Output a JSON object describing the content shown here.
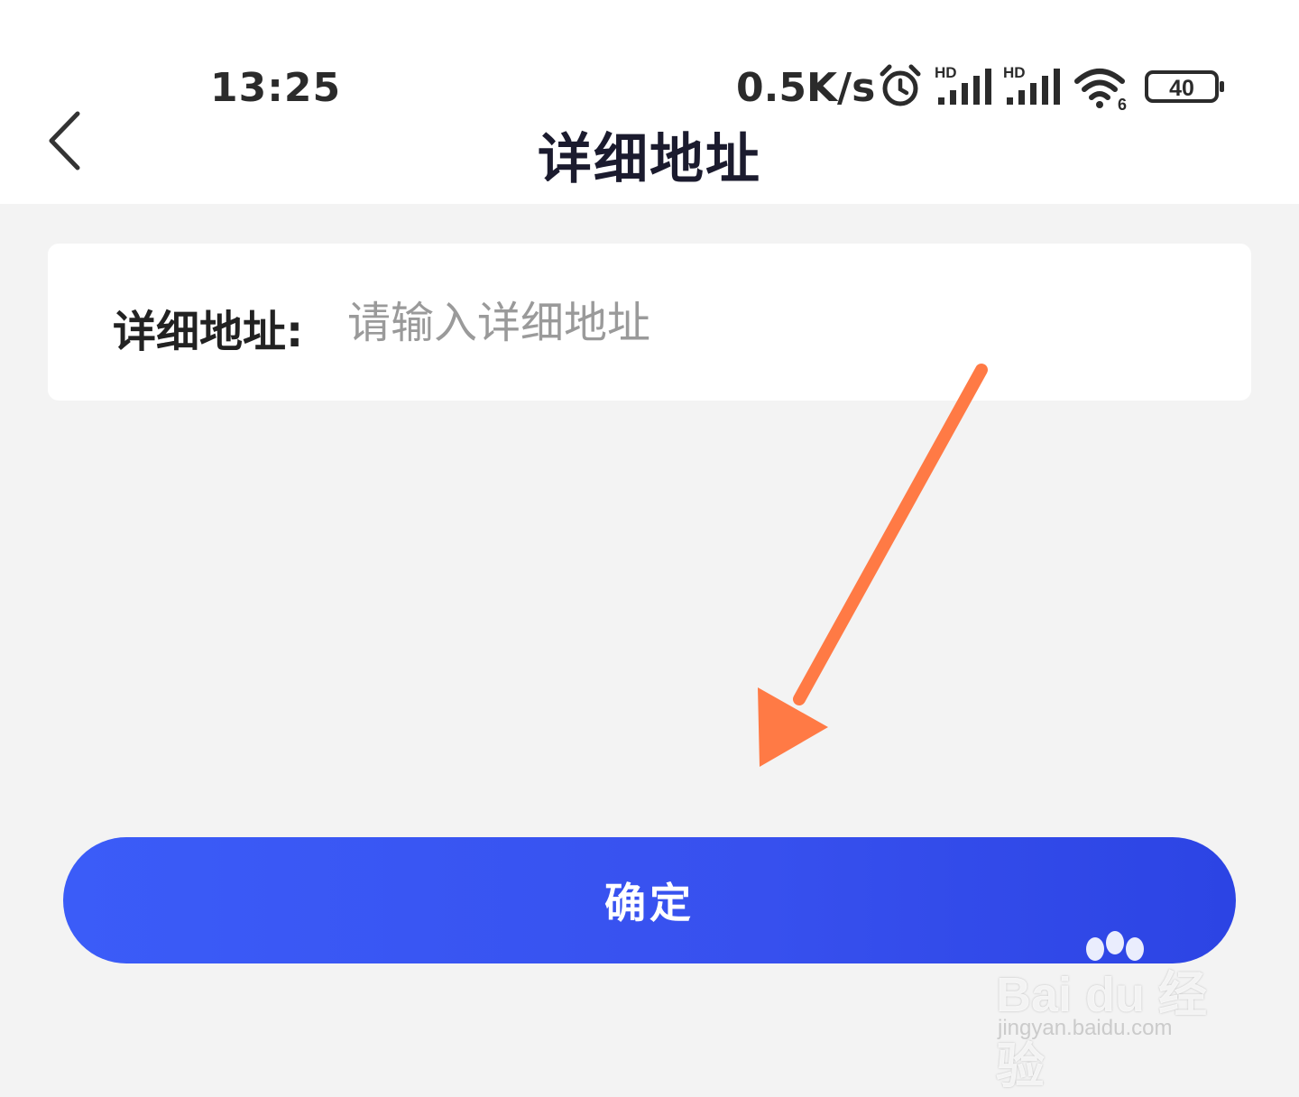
{
  "status_bar": {
    "time": "13:25",
    "network_speed": "0.5K/s",
    "signal_badge_1": "HD",
    "signal_badge_2": "HD",
    "wifi_badge": "6",
    "battery": "40",
    "icons": [
      "alarm-icon",
      "signal-icon",
      "signal-icon",
      "wifi-icon",
      "battery-icon"
    ]
  },
  "header": {
    "back_icon": "chevron-left-icon",
    "title": "详细地址"
  },
  "form": {
    "address_label": "详细地址:",
    "address_value": "",
    "address_placeholder": "请输入详细地址"
  },
  "confirm_label": "确定",
  "annotation": {
    "arrow_color": "#ff7a45"
  },
  "watermark": {
    "brand": "Bai du 经验",
    "url": "jingyan.baidu.com"
  },
  "colors": {
    "accent": "#3a56f2",
    "background": "#f3f3f3"
  }
}
